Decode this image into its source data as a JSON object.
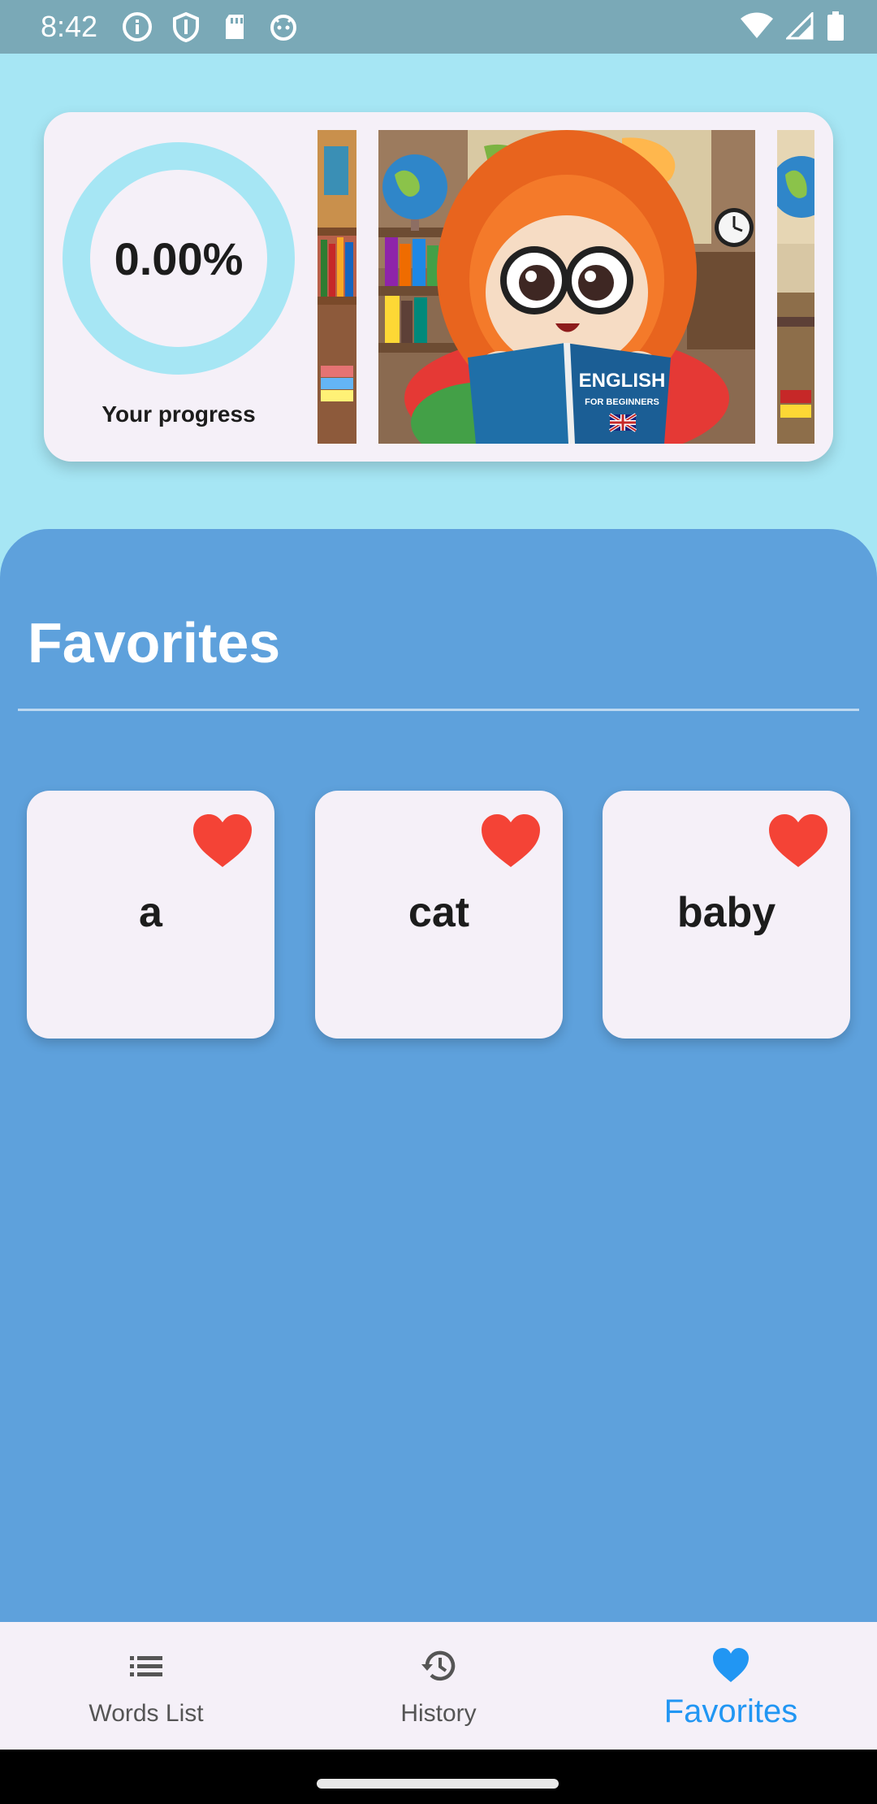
{
  "status_bar": {
    "time": "8:42",
    "left_icons": [
      "info-icon",
      "shield-icon",
      "sd-card-icon",
      "android-face-icon"
    ],
    "right_icons": [
      "wifi-icon",
      "signal-icon",
      "battery-icon"
    ]
  },
  "progress": {
    "value_text": "0.00%",
    "fraction": 0.0,
    "label": "Your progress",
    "ring_color": "#a6e6f4"
  },
  "carousel": {
    "book_title": "ENGLISH",
    "book_subtitle": "FOR BEGINNERS"
  },
  "favorites": {
    "title": "Favorites",
    "words": [
      {
        "word": "a",
        "favorited": true
      },
      {
        "word": "cat",
        "favorited": true
      },
      {
        "word": "baby",
        "favorited": true
      }
    ],
    "heart_color": "#f44336"
  },
  "bottom_nav": {
    "items": [
      {
        "label": "Words List",
        "icon": "list-icon",
        "active": false
      },
      {
        "label": "History",
        "icon": "history-icon",
        "active": false
      },
      {
        "label": "Favorites",
        "icon": "heart-icon",
        "active": true
      }
    ],
    "active_color": "#2196f3"
  },
  "colors": {
    "background": "#a6e6f4",
    "panel": "#5ea1dc",
    "card": "#f5f0f8"
  }
}
